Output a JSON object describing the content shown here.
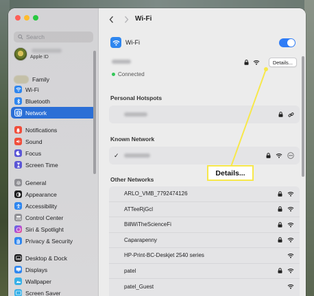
{
  "sidebar": {
    "search_placeholder": "Search",
    "apple_id_label": "Apple ID",
    "family_label": "Family",
    "items": [
      {
        "label": "Wi-Fi",
        "icon": "wifi-icon",
        "color": "#2e86ef"
      },
      {
        "label": "Bluetooth",
        "icon": "bluetooth-icon",
        "color": "#2e86ef"
      },
      {
        "label": "Network",
        "icon": "globe-icon",
        "color": "#2e86ef",
        "selected": true
      },
      {
        "label": "Notifications",
        "icon": "bell-icon",
        "color": "#f04d3a"
      },
      {
        "label": "Sound",
        "icon": "speaker-icon",
        "color": "#f04d3a"
      },
      {
        "label": "Focus",
        "icon": "moon-icon",
        "color": "#5b56d6"
      },
      {
        "label": "Screen Time",
        "icon": "hourglass-icon",
        "color": "#5b56d6"
      },
      {
        "label": "General",
        "icon": "gear-icon",
        "color": "#8e8e93"
      },
      {
        "label": "Appearance",
        "icon": "appearance-icon",
        "color": "#1c1c1e"
      },
      {
        "label": "Accessibility",
        "icon": "accessibility-icon",
        "color": "#2e86ef"
      },
      {
        "label": "Control Center",
        "icon": "control-center-icon",
        "color": "#8e8e93"
      },
      {
        "label": "Siri & Spotlight",
        "icon": "siri-icon",
        "color": "#b44fd6"
      },
      {
        "label": "Privacy & Security",
        "icon": "hand-icon",
        "color": "#2e86ef"
      },
      {
        "label": "Desktop & Dock",
        "icon": "dock-icon",
        "color": "#1c1c1e"
      },
      {
        "label": "Displays",
        "icon": "display-icon",
        "color": "#2e86ef"
      },
      {
        "label": "Wallpaper",
        "icon": "wallpaper-icon",
        "color": "#36b0e8"
      },
      {
        "label": "Screen Saver",
        "icon": "screensaver-icon",
        "color": "#36b0e8"
      }
    ]
  },
  "toolbar": {
    "title": "Wi-Fi"
  },
  "wifi": {
    "label": "Wi-Fi",
    "enabled": true
  },
  "connected": {
    "status": "Connected",
    "details_label": "Details..."
  },
  "personal_hotspots": {
    "title": "Personal Hotspots"
  },
  "known_network": {
    "title": "Known Network"
  },
  "other_networks": {
    "title": "Other Networks",
    "items": [
      "ARLO_VMB_7792474126",
      "ATTeeRjGcl",
      "BillWiTheScienceFi",
      "Caparapenny",
      "HP-Print-BC-Deskjet 2540 series",
      "patel",
      "patel_Guest"
    ]
  },
  "callout": {
    "label": "Details..."
  },
  "colors": {
    "accent": "#2e7cf6",
    "selection": "#2b6fd6",
    "callout_border": "#f7e84a"
  }
}
